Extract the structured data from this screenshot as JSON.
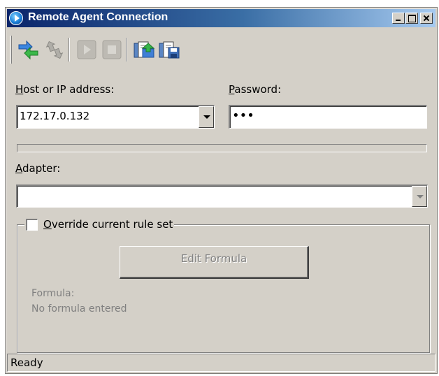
{
  "window": {
    "title": "Remote Agent Connection"
  },
  "toolbar": {
    "buttons": [
      {
        "name": "connect",
        "icon": "connect-arrows-icon",
        "enabled": true
      },
      {
        "name": "disconnect",
        "icon": "disconnect-arrows-icon",
        "enabled": false
      },
      {
        "name": "start",
        "icon": "play-icon",
        "enabled": false
      },
      {
        "name": "stop",
        "icon": "stop-icon",
        "enabled": false
      },
      {
        "name": "export",
        "icon": "folder-export-icon",
        "enabled": true
      },
      {
        "name": "save",
        "icon": "folder-save-icon",
        "enabled": true
      }
    ]
  },
  "form": {
    "host_label_underlined": "H",
    "host_label_rest": "ost or IP address:",
    "host_value": "172.17.0.132",
    "password_label_underlined": "P",
    "password_label_rest": "assword:",
    "password_value": "•••",
    "progress": 0,
    "adapter_label_underlined": "A",
    "adapter_label_rest": "dapter:",
    "adapter_value": ""
  },
  "rules": {
    "override_underlined": "O",
    "override_rest": "verride current rule set",
    "override_checked": false,
    "edit_formula_button": "Edit Formula",
    "formula_label": "Formula:",
    "formula_value": "No formula entered"
  },
  "status": {
    "text": "Ready"
  },
  "colors": {
    "titlebar_start": "#0a246a",
    "titlebar_end": "#a6caf0",
    "face": "#d4d0c8",
    "disabled_text": "#808080"
  }
}
